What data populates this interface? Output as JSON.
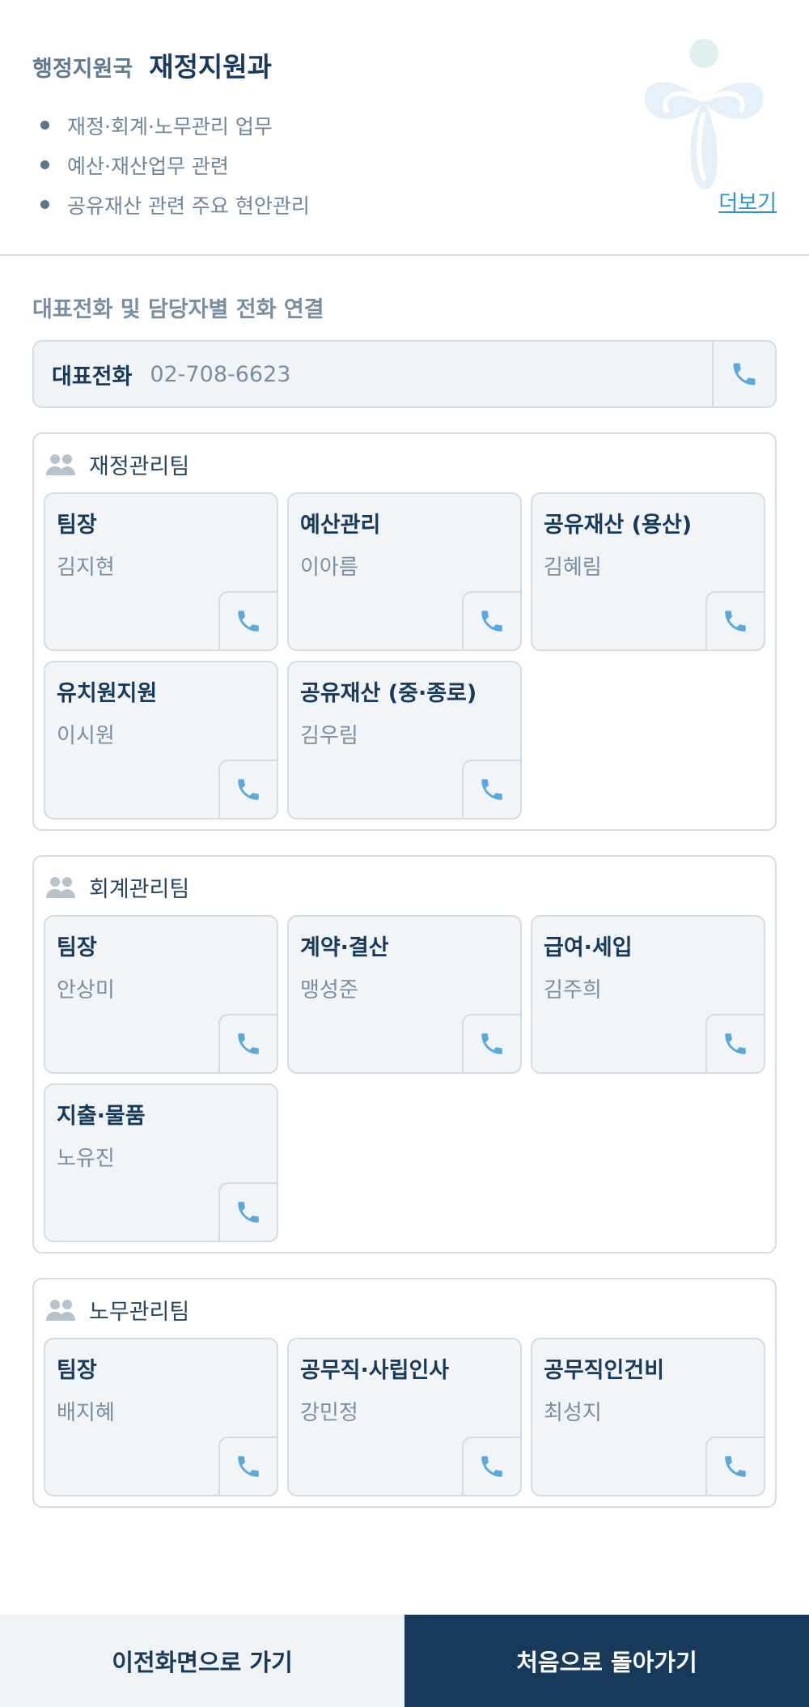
{
  "header": {
    "bureau": "행정지원국",
    "division": "재정지원과",
    "duties": [
      "재정·회계·노무관리 업무",
      "예산·재산업무 관련",
      "공유재산 관련 주요 현안관리"
    ],
    "more_label": "더보기"
  },
  "contact_section_title": "대표전화 및 담당자별 전화 연결",
  "main_phone": {
    "label": "대표전화",
    "number": "02-708-6623"
  },
  "teams": [
    {
      "name": "재정관리팀",
      "members": [
        {
          "role": "팀장",
          "name": "김지현"
        },
        {
          "role": "예산관리",
          "name": "이아름"
        },
        {
          "role": "공유재산 (용산)",
          "name": "김혜림"
        },
        {
          "role": "유치원지원",
          "name": "이시원"
        },
        {
          "role": "공유재산 (중·종로)",
          "name": "김우림"
        }
      ]
    },
    {
      "name": "회계관리팀",
      "members": [
        {
          "role": "팀장",
          "name": "안상미"
        },
        {
          "role": "계약·결산",
          "name": "맹성준"
        },
        {
          "role": "급여·세입",
          "name": "김주희"
        },
        {
          "role": "지출·물품",
          "name": "노유진"
        }
      ]
    },
    {
      "name": "노무관리팀",
      "members": [
        {
          "role": "팀장",
          "name": "배지혜"
        },
        {
          "role": "공무직·사립인사",
          "name": "강민정"
        },
        {
          "role": "공무직인건비",
          "name": "최성지"
        }
      ]
    }
  ],
  "footer": {
    "prev_label": "이전화면으로 가기",
    "home_label": "처음으로 돌아가기"
  },
  "colors": {
    "navy": "#173a5a",
    "phone_icon": "#5aa9de",
    "border": "#d5dde4",
    "card_bg": "#f1f5f8"
  },
  "icons": {
    "phone": "phone-icon",
    "team": "people-icon"
  }
}
